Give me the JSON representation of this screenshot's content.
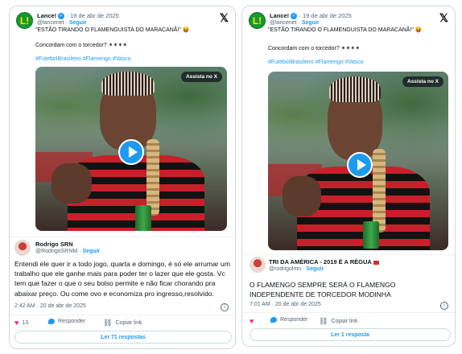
{
  "tweets": [
    {
      "author": {
        "name": "Lance!",
        "date": "19 de abr de 2025",
        "handle": "@lancenet",
        "follow": "Seguir",
        "logo_letter": "L!"
      },
      "lines": [
        "\"ESTÃO TIRANDO O FLAMENGUISTA DO MARACANÃ!\" 😝",
        "Concordam com o torcedor? ✶✶✶✶",
        "#FuteboIBrasileiro #Flamengo #Vasco"
      ],
      "video": {
        "badge": "Assista no X"
      },
      "reply": {
        "name": "Rodrigo SRN",
        "handle": "@RodrigoSRNM",
        "follow": "Seguir",
        "text": "Entendi ele quer ir a todo jogo, quarta e domingo, é só ele arrumar um trabalho que ele ganhe mais para poder ter o lazer que ele gosta. Vc tem que fazer o que o seu bolso permite e não ficar chorando pra abaixar preço. Ou come ovo e economiza pro ingresso,resolvido.",
        "date": "2:42 AM · 20 de abr de 2025"
      },
      "actions": {
        "likes": "13",
        "reply": "Responder",
        "copy": "Copiar link"
      },
      "read_more": "Ler 71 respostas"
    },
    {
      "author": {
        "name": "Lance!",
        "date": "19 de abr de 2025",
        "handle": "@lancenet",
        "follow": "Seguir",
        "logo_letter": "L!"
      },
      "lines": [
        "\"ESTÃO TIRANDO O FLAMENGUISTA DO MARACANÃ!\" 😝",
        "Concordam com o torcedor? ✶✶✶✶",
        "#FuteboIBrasileiro #Flamengo #Vasco"
      ],
      "video": {
        "badge": "Assista no X"
      },
      "reply": {
        "name": "TRI DA AMÉRICA - 2019 É A RÉGUA",
        "handle": "@rodrigolmn",
        "follow": "Seguir",
        "text": "O FLAMENGO SEMPRE SERÁ O FLAMENGO INDEPENDENTE DE TORCEDOR MODINHA",
        "date": "7:01 AM · 20 de abr de 2025"
      },
      "actions": {
        "likes": "",
        "reply": "Responder",
        "copy": "Copiar link"
      },
      "read_more": "Ler 1 resposta"
    }
  ],
  "colors": {
    "accent": "#1d9bf0",
    "heart": "#f91880",
    "brand_green": "#159a30"
  }
}
